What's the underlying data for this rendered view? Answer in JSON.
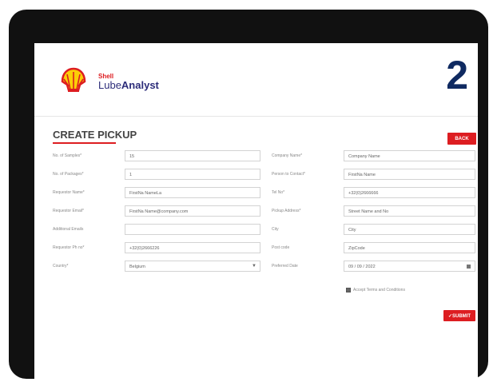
{
  "step_number": "2",
  "brand": {
    "shell": "Shell",
    "lube": "Lube",
    "analyst": "Analyst"
  },
  "page_title": "CREATE PICKUP",
  "back_label": "BACK",
  "left_fields": [
    {
      "label": "No. of Samples*",
      "value": "15"
    },
    {
      "label": "No. of Packages*",
      "value": "1"
    },
    {
      "label": "Requestor Name*",
      "value": "FirstNa NameLa"
    },
    {
      "label": "Requestor Email*",
      "value": "FirstNa Name@company.com"
    },
    {
      "label": "Additional Emails",
      "value": ""
    },
    {
      "label": "Requestor Ph no*",
      "value": "+32(0)2666226"
    },
    {
      "label": "Country*",
      "value": "Belgium"
    }
  ],
  "right_fields": [
    {
      "label": "Company Name*",
      "value": "Company Name"
    },
    {
      "label": "Person to Contact*",
      "value": "FirstNa Name"
    },
    {
      "label": "Tel No*",
      "value": "+32(0)2666666"
    },
    {
      "label": "Pickup Address*",
      "value": "Street Name and No"
    },
    {
      "label": "City",
      "value": "City"
    },
    {
      "label": "Post code",
      "value": "ZipCode"
    },
    {
      "label": "Preferred Date",
      "value": "09 / 09 / 2022"
    }
  ],
  "terms_label": "Accept Terms and Conditions",
  "submit_label": "SUBMIT",
  "colors": {
    "brand_red": "#dd1d21",
    "brand_yellow": "#fbce07",
    "step_navy": "#0f2a61",
    "frame": "#111111"
  },
  "icons": [
    "shell-pecten-logo",
    "chevron-down-icon",
    "calendar-icon",
    "checkbox-icon",
    "check-icon"
  ]
}
